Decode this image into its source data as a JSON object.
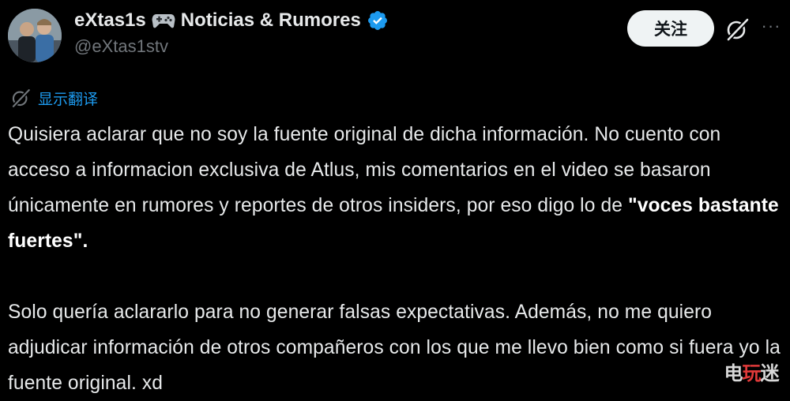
{
  "author": {
    "display_name": "eXtas1s",
    "name_suffix": "Noticias & Rumores",
    "handle": "@eXtas1stv",
    "verified_color": "#1d9bf0"
  },
  "actions": {
    "follow_label": "关注",
    "grok_icon": "grok-icon",
    "more_icon": "more-icon"
  },
  "translate": {
    "label": "显示翻译",
    "icon": "grok-icon"
  },
  "tweet": {
    "p1_text": "Quisiera aclarar que no soy la fuente original de dicha información. No cuento con acceso a informacion exclusiva de Atlus, mis comentarios en el video se basaron únicamente en rumores y reportes de otros insiders, por eso digo lo de ",
    "p1_bold": "\"voces bastante fuertes\".",
    "p2_text": "Solo quería aclararlo para no generar falsas expectativas. Además, no me quiero adjudicar información de otros compañeros con los que me llevo bien como si fuera yo la fuente original. xd"
  },
  "watermark": {
    "left": "电",
    "mid": "玩",
    "right": "迷"
  },
  "colors": {
    "background": "#000000",
    "text": "#e7e9ea",
    "muted": "#71767b",
    "link": "#1d9bf0",
    "follow_bg": "#eff3f4"
  }
}
